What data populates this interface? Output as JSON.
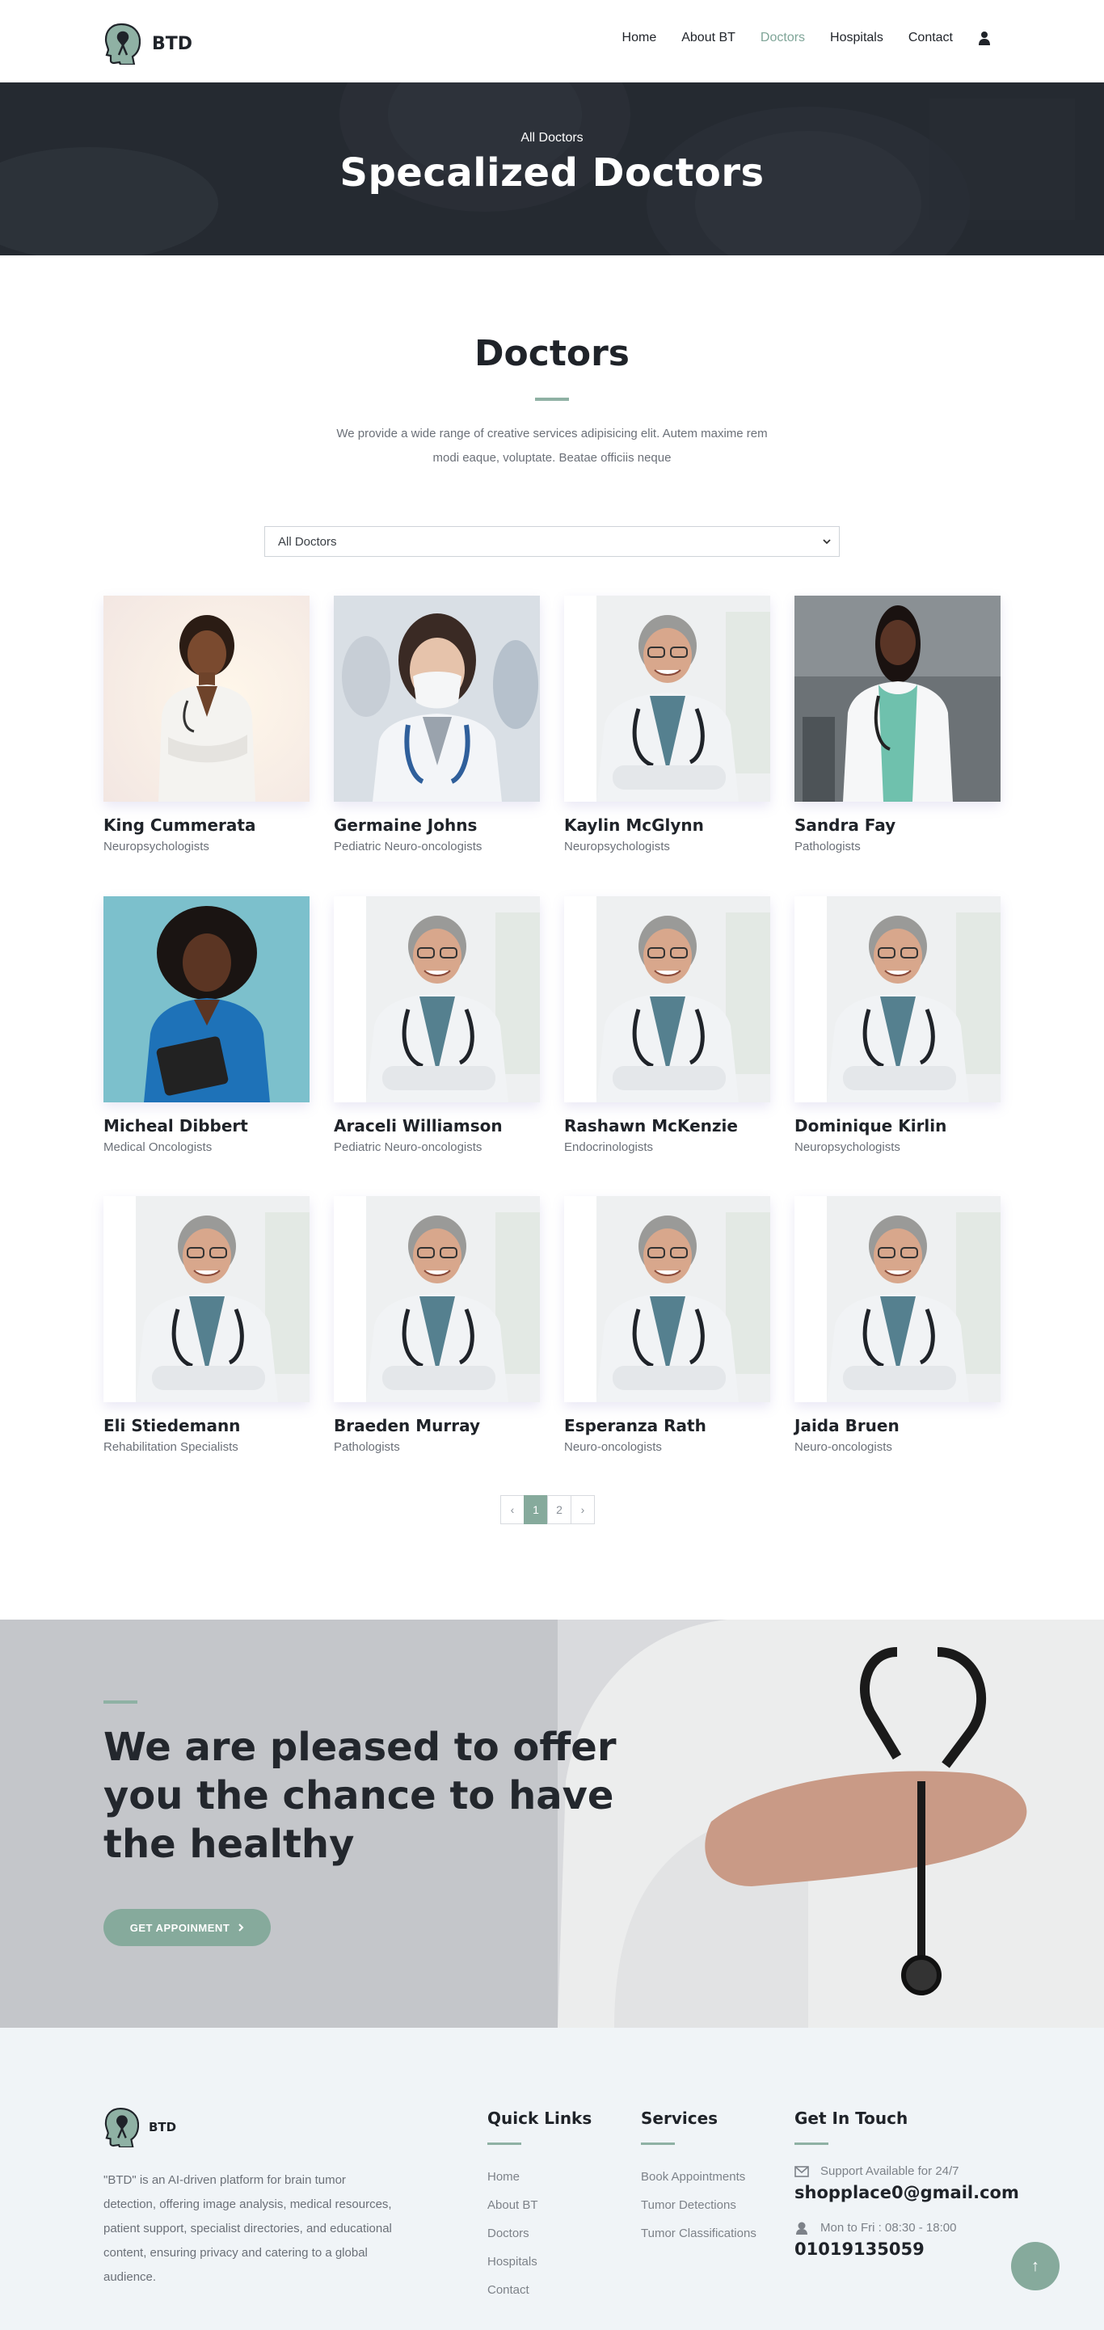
{
  "brand": {
    "name": "BTD"
  },
  "nav": {
    "items": [
      {
        "label": "Home",
        "active": false
      },
      {
        "label": "About BT",
        "active": false
      },
      {
        "label": "Doctors",
        "active": true
      },
      {
        "label": "Hospitals",
        "active": false
      },
      {
        "label": "Contact",
        "active": false
      }
    ],
    "user_icon": "user-icon"
  },
  "hero": {
    "subtitle": "All Doctors",
    "title": "Specalized Doctors"
  },
  "doctors_section": {
    "title": "Doctors",
    "description": "We provide a wide range of creative services adipisicing elit. Autem maxime rem modi eaque, voluptate. Beatae officiis neque",
    "filter": {
      "selected": "All Doctors"
    },
    "doctors": [
      {
        "name": "King Cummerata",
        "specialty": "Neuropsychologists",
        "photo": "female-doctor-arms-crossed"
      },
      {
        "name": "Germaine Johns",
        "specialty": "Pediatric Neuro-oncologists",
        "photo": "female-doctor-mask"
      },
      {
        "name": "Kaylin McGlynn",
        "specialty": "Neuropsychologists",
        "photo": "male-doctor-glasses"
      },
      {
        "name": "Sandra Fay",
        "specialty": "Pathologists",
        "photo": "female-doctor-scrubs"
      },
      {
        "name": "Micheal Dibbert",
        "specialty": "Medical Oncologists",
        "photo": "female-nurse-blue-scrubs"
      },
      {
        "name": "Araceli Williamson",
        "specialty": "Pediatric Neuro-oncologists",
        "photo": "male-doctor-glasses"
      },
      {
        "name": "Rashawn McKenzie",
        "specialty": "Endocrinologists",
        "photo": "male-doctor-glasses"
      },
      {
        "name": "Dominique Kirlin",
        "specialty": "Neuropsychologists",
        "photo": "male-doctor-glasses"
      },
      {
        "name": "Eli Stiedemann",
        "specialty": "Rehabilitation Specialists",
        "photo": "male-doctor-glasses"
      },
      {
        "name": "Braeden Murray",
        "specialty": "Pathologists",
        "photo": "male-doctor-glasses"
      },
      {
        "name": "Esperanza Rath",
        "specialty": "Neuro-oncologists",
        "photo": "male-doctor-glasses"
      },
      {
        "name": "Jaida Bruen",
        "specialty": "Neuro-oncologists",
        "photo": "male-doctor-glasses"
      }
    ]
  },
  "pagination": {
    "prev": "‹",
    "pages": [
      "1",
      "2"
    ],
    "current": "1",
    "next": "›"
  },
  "cta": {
    "title": "We are pleased to offer you the chance to have the healthy",
    "button_label": "GET APPOINMENT",
    "button_icon": "chevron-right-icon"
  },
  "footer": {
    "brand": "BTD",
    "about": "\"BTD\" is an AI-driven platform for brain tumor detection, offering image analysis, medical resources, patient support, specialist directories, and educational content, ensuring privacy and catering to a global audience.",
    "quick_links": {
      "title": "Quick Links",
      "items": [
        "Home",
        "About BT",
        "Doctors",
        "Hospitals",
        "Contact"
      ]
    },
    "services": {
      "title": "Services",
      "items": [
        "Book Appointments",
        "Tumor Detections",
        "Tumor Classifications"
      ]
    },
    "contact": {
      "title": "Get In Touch",
      "support_label": "Support Available for 24/7",
      "email": "shopplace0@gmail.com",
      "hours_label": "Mon to Fri : 08:30 - 18:00",
      "phone": "01019135059"
    },
    "back_to_top": "↑"
  },
  "colors": {
    "accent": "#86aa9c",
    "hero_bg": "#232830",
    "footer_bg": "#f0f4f7",
    "text_dark": "#1f2329",
    "text_muted": "#6b7078"
  }
}
